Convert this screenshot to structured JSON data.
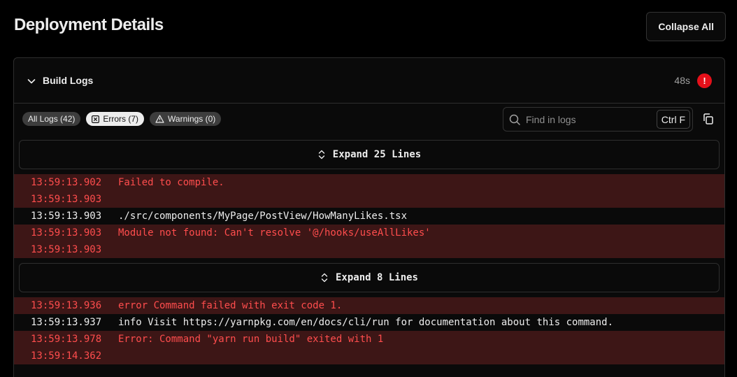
{
  "header": {
    "title": "Deployment Details",
    "collapse_label": "Collapse All"
  },
  "panel": {
    "title": "Build Logs",
    "duration": "48s",
    "status_icon": "alert-icon",
    "status_color": "#e5101a",
    "status_glyph": "!"
  },
  "filters": {
    "all": "All Logs (42)",
    "errors": "Errors (7)",
    "warnings": "Warnings (0)",
    "selected": "errors"
  },
  "search": {
    "placeholder": "Find in logs",
    "value": "",
    "shortcut": "Ctrl F"
  },
  "expand": [
    {
      "label": "Expand 25 Lines"
    },
    {
      "label": "Expand 8 Lines"
    }
  ],
  "logs": [
    {
      "time": "13:59:13.902",
      "message": "Failed to compile.",
      "level": "error"
    },
    {
      "time": "13:59:13.903",
      "message": "",
      "level": "error"
    },
    {
      "time": "13:59:13.903",
      "message": "./src/components/MyPage/PostView/HowManyLikes.tsx",
      "level": "info"
    },
    {
      "time": "13:59:13.903",
      "message": "Module not found: Can't resolve '@/hooks/useAllLikes'",
      "level": "error"
    },
    {
      "time": "13:59:13.903",
      "message": "",
      "level": "error"
    },
    {
      "time": "13:59:13.936",
      "message": "error Command failed with exit code 1.",
      "level": "error"
    },
    {
      "time": "13:59:13.937",
      "message": "info Visit https://yarnpkg.com/en/docs/cli/run for documentation about this command.",
      "level": "info"
    },
    {
      "time": "13:59:13.978",
      "message": "Error: Command \"yarn run build\" exited with 1",
      "level": "error"
    },
    {
      "time": "13:59:14.362",
      "message": "",
      "level": "error"
    }
  ],
  "colors": {
    "error_bg": "#3d1616",
    "error_text": "#ff4d4d",
    "background": "#000000"
  }
}
